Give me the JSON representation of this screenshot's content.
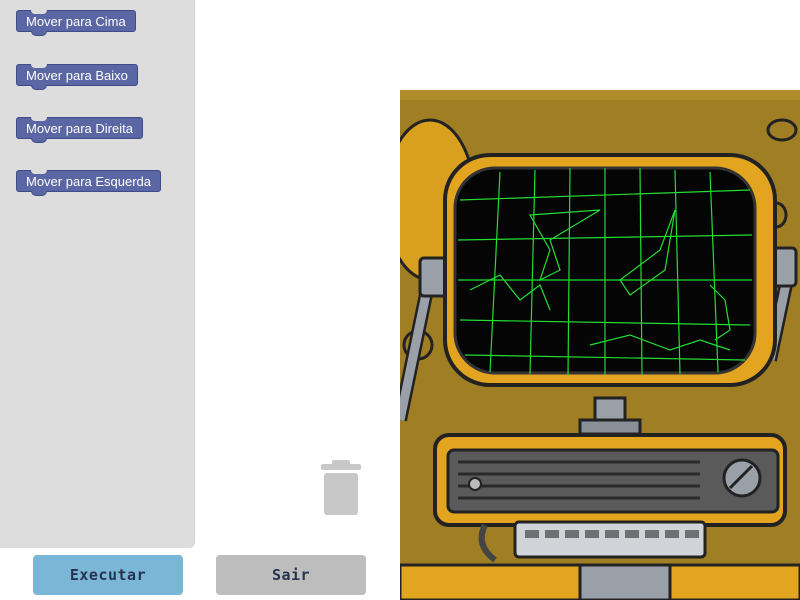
{
  "toolbox": {
    "blocks": [
      {
        "label": "Mover para Cima"
      },
      {
        "label": "Mover para Baixo"
      },
      {
        "label": "Mover para Direita"
      },
      {
        "label": "Mover para Esquerda"
      }
    ]
  },
  "bottom_bar": {
    "run_label": "Executar",
    "exit_label": "Sair"
  },
  "scene": {
    "description_icon": "retro-computer-monitor-icon"
  },
  "colors": {
    "block": "#5b67a5",
    "toolbox_bg": "#dddddd",
    "run_button": "#7ab7d6",
    "exit_button": "#bdbdbd",
    "scene_bg": "#a07e24",
    "screen_grid": "#22dd33"
  }
}
